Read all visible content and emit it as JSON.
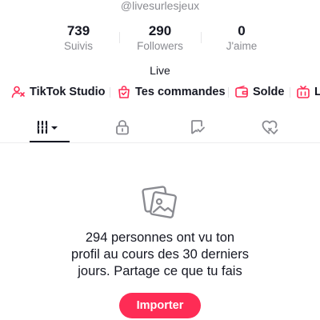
{
  "profile": {
    "username": "@livesurlesjeux",
    "bio": "Live"
  },
  "stats": [
    {
      "value": "739",
      "label": "Suivis"
    },
    {
      "value": "290",
      "label": "Followers"
    },
    {
      "value": "0",
      "label": "J'aime"
    }
  ],
  "shortcuts": [
    {
      "label": "TikTok Studio",
      "icon": "tiktok-studio-icon"
    },
    {
      "label": "Tes commandes",
      "icon": "shopping-bag-icon"
    },
    {
      "label": "Solde",
      "icon": "wallet-icon"
    },
    {
      "label": "LI",
      "icon": "live-tv-icon"
    }
  ],
  "tabs": [
    {
      "name": "videos-grid",
      "icon": "grid-icon",
      "selected": true
    },
    {
      "name": "private",
      "icon": "lock-icon",
      "selected": false
    },
    {
      "name": "reposts",
      "icon": "repost-icon",
      "selected": false
    },
    {
      "name": "liked",
      "icon": "heart-icon",
      "selected": false
    }
  ],
  "empty_state": {
    "icon": "photos-icon",
    "lines": [
      "294 personnes ont vu ton",
      "profil au cours des 30 derniers",
      "jours. Partage ce que tu fais"
    ],
    "button_label": "Importer"
  },
  "colors": {
    "accent": "#fe2c55",
    "text": "#161823",
    "muted": "#8a8b91"
  }
}
